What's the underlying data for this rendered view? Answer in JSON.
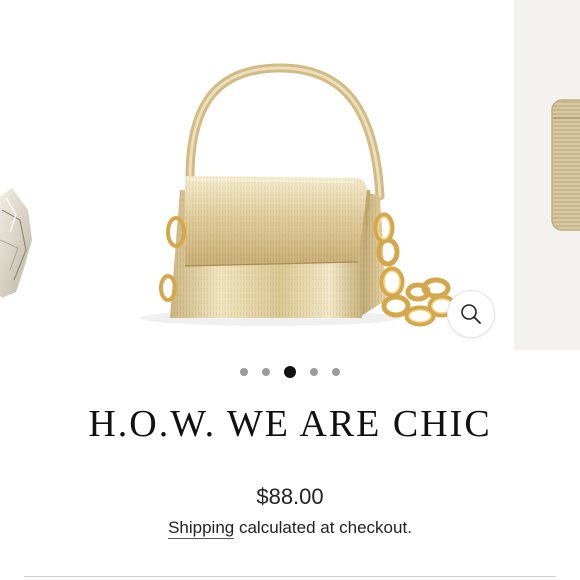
{
  "product": {
    "title": "H.O.W. WE ARE CHIC",
    "price": "$88.00",
    "shipping_link": "Shipping",
    "shipping_rest": " calculated at checkout."
  },
  "gallery": {
    "slide_count": 5,
    "active_index": 2,
    "zoom_icon": "magnifier-icon",
    "colors": {
      "gold_light": "#efe2b8",
      "gold_mid": "#d8c188",
      "gold_dark": "#b49a5c",
      "chain": "#d4a84a"
    }
  }
}
